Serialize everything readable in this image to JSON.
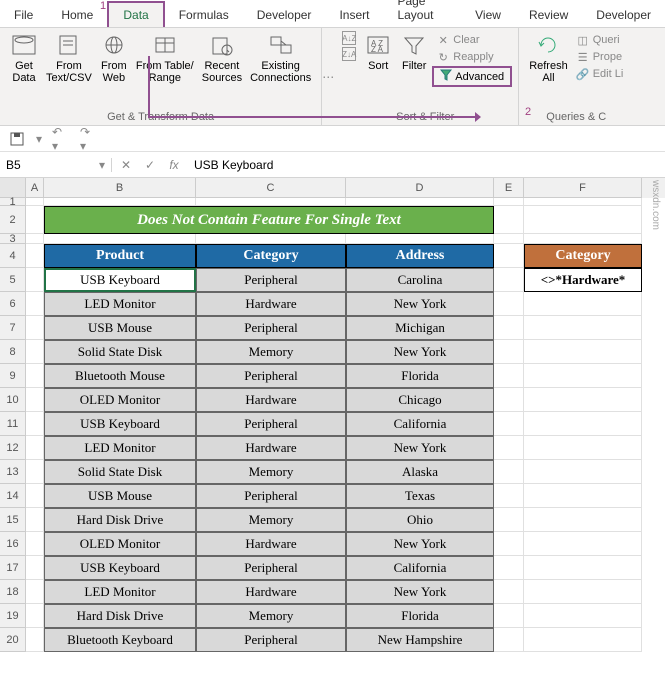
{
  "tabs": [
    "File",
    "Home",
    "Data",
    "Formulas",
    "Developer",
    "Insert",
    "Page Layout",
    "View",
    "Review",
    "Developer"
  ],
  "active_tab": "Data",
  "marker1": "1",
  "marker2": "2",
  "ribbon": {
    "get_data": "Get\nData",
    "from_textcsv": "From\nText/CSV",
    "from_web": "From\nWeb",
    "from_table": "From Table/\nRange",
    "recent": "Recent\nSources",
    "existing": "Existing\nConnections",
    "group1": "Get & Transform Data",
    "sort_az": "A→Z",
    "sort_za": "Z→A",
    "sort": "Sort",
    "filter": "Filter",
    "clear": "Clear",
    "reapply": "Reapply",
    "advanced": "Advanced",
    "group2": "Sort & Filter",
    "refresh": "Refresh\nAll",
    "queries": "Queri",
    "properties": "Prope",
    "editlinks": "Edit Li",
    "group3": "Queries & C"
  },
  "namebox": "B5",
  "formula": "USB Keyboard",
  "cols": [
    "A",
    "B",
    "C",
    "D",
    "E",
    "F"
  ],
  "title": "Does Not Contain Feature For Single Text",
  "headers": {
    "b": "Product",
    "c": "Category",
    "d": "Address"
  },
  "criteria_header": "Category",
  "criteria_value": "<>*Hardware*",
  "rows": [
    {
      "n": 5,
      "b": "USB Keyboard",
      "c": "Peripheral",
      "d": "Carolina"
    },
    {
      "n": 6,
      "b": "LED Monitor",
      "c": "Hardware",
      "d": "New York"
    },
    {
      "n": 7,
      "b": "USB Mouse",
      "c": "Peripheral",
      "d": "Michigan"
    },
    {
      "n": 8,
      "b": "Solid State Disk",
      "c": "Memory",
      "d": "New York"
    },
    {
      "n": 9,
      "b": "Bluetooth Mouse",
      "c": "Peripheral",
      "d": "Florida"
    },
    {
      "n": 10,
      "b": "OLED Monitor",
      "c": "Hardware",
      "d": "Chicago"
    },
    {
      "n": 11,
      "b": "USB Keyboard",
      "c": "Peripheral",
      "d": "California"
    },
    {
      "n": 12,
      "b": "LED Monitor",
      "c": "Hardware",
      "d": "New York"
    },
    {
      "n": 13,
      "b": "Solid State Disk",
      "c": "Memory",
      "d": "Alaska"
    },
    {
      "n": 14,
      "b": "USB Mouse",
      "c": "Peripheral",
      "d": "Texas"
    },
    {
      "n": 15,
      "b": "Hard Disk Drive",
      "c": "Memory",
      "d": "Ohio"
    },
    {
      "n": 16,
      "b": "OLED Monitor",
      "c": "Hardware",
      "d": "New York"
    },
    {
      "n": 17,
      "b": "USB Keyboard",
      "c": "Peripheral",
      "d": "California"
    },
    {
      "n": 18,
      "b": "LED Monitor",
      "c": "Hardware",
      "d": "New York"
    },
    {
      "n": 19,
      "b": "Hard Disk Drive",
      "c": "Memory",
      "d": "Florida"
    },
    {
      "n": 20,
      "b": "Bluetooth Keyboard",
      "c": "Peripheral",
      "d": "New Hampshire"
    }
  ],
  "watermark": "wsxdn.com"
}
